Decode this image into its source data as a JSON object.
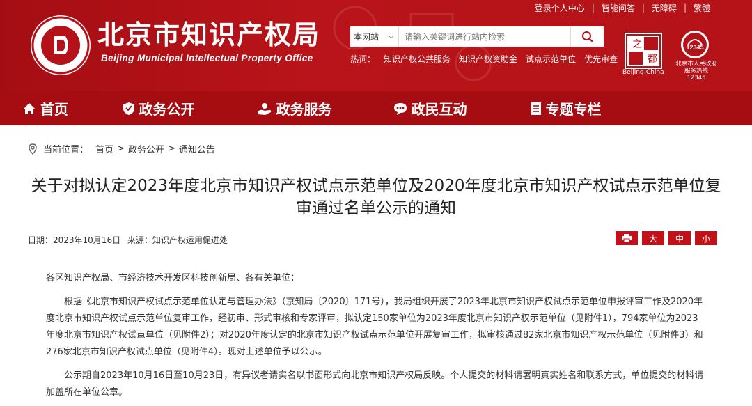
{
  "header": {
    "top_links": [
      "登录个人中心",
      "智能问答",
      "无障碍",
      "繁體"
    ],
    "title": "北京市知识产权局",
    "subtitle": "Beijing Municipal Intellectual Property Office",
    "search": {
      "scope": "本网站",
      "placeholder": "请输入关键词进行站内检索"
    },
    "hot_label": "热词：",
    "hot_words": [
      "知识产权公共服务",
      "知识产权资助金",
      "试点示范单位",
      "优先审查"
    ],
    "capital_caption": "Beijing-China",
    "hotline_number": "12345",
    "hotline_caption": "北京市人民政府服务热线12345"
  },
  "nav": [
    {
      "label": "首页",
      "icon": "home-icon"
    },
    {
      "label": "政务公开",
      "icon": "shield-icon"
    },
    {
      "label": "政务服务",
      "icon": "hand-icon"
    },
    {
      "label": "政民互动",
      "icon": "chat-icon"
    },
    {
      "label": "专题专栏",
      "icon": "doc-icon"
    }
  ],
  "breadcrumb": {
    "prefix": "当前位置：",
    "items": [
      "首页",
      "政务公开",
      "通知公告"
    ],
    "separator": ">"
  },
  "article": {
    "title_line1": "关于对拟认定2023年度北京市知识产权试点示范单位及2020年度北京市知识产权试点示范单位复",
    "title_line2": "审通过名单公示的通知",
    "date": "日期：2023年10月16日",
    "source": "来源：知识产权运用促进处",
    "font_buttons": [
      "大",
      "中",
      "小"
    ],
    "paragraphs": [
      "各区知识产权局、市经济技术开发区科技创新局、各有关单位：",
      "根据《北京市知识产权试点示范单位认定与管理办法》（京知局〔2020〕171号），我局组织开展了2023年北京市知识产权试点示范单位申报评审工作及2020年度北京市知识产权试点示范单位复审工作，经初审、形式审核和专家评审，拟认定150家单位为2023年度北京市知识产权示范单位（见附件1），794家单位为2023年度北京市知识产权试点单位（见附件2）；对2020年度认定的北京市知识产权试点示范单位开展复审工作，拟审核通过82家北京市知识产权示范单位（见附件3）和276家北京市知识产权试点单位（见附件4）。现对上述单位予以公示。",
      "公示期自2023年10月16日至10月23日，有异议者请实名以书面形式向北京市知识产权局反映。个人提交的材料请署明真实姓名和联系方式，单位提交的材料请加盖所在单位公章。"
    ]
  },
  "colors": {
    "brand_red": "#b41218",
    "nav_red": "#a50d13",
    "button_red": "#c1121a"
  }
}
